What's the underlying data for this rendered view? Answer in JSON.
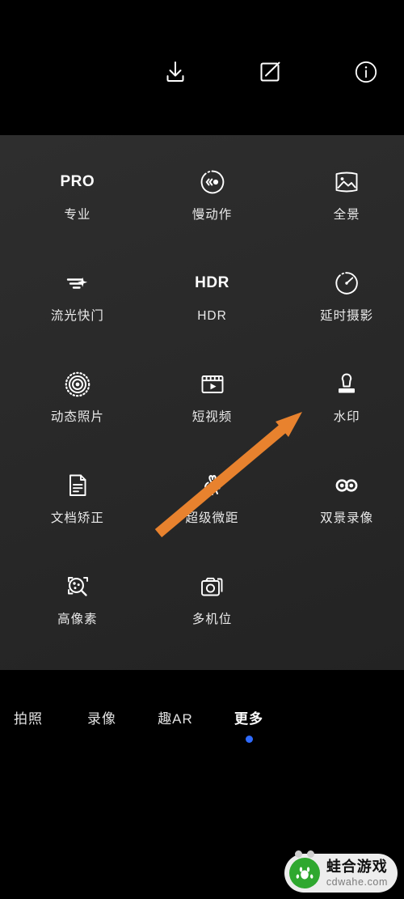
{
  "app": {
    "background_color": "#000000",
    "panel_color": "#2b2b2b"
  },
  "toolbar": {
    "buttons": [
      {
        "name": "download-icon",
        "label": "下载"
      },
      {
        "name": "edit-icon",
        "label": "编辑"
      },
      {
        "name": "info-icon",
        "label": "详情"
      }
    ]
  },
  "mode_panel": {
    "rows": [
      [
        {
          "icon": "pro-text-icon",
          "icon_text": "PRO",
          "label": "专业"
        },
        {
          "icon": "slow-motion-icon",
          "icon_text": "",
          "label": "慢动作"
        },
        {
          "icon": "panorama-icon",
          "icon_text": "",
          "label": "全景"
        }
      ],
      [
        {
          "icon": "light-painting-icon",
          "icon_text": "",
          "label": "流光快门"
        },
        {
          "icon": "hdr-text-icon",
          "icon_text": "HDR",
          "label": "HDR"
        },
        {
          "icon": "time-lapse-icon",
          "icon_text": "",
          "label": "延时摄影"
        }
      ],
      [
        {
          "icon": "live-photo-icon",
          "icon_text": "",
          "label": "动态照片"
        },
        {
          "icon": "short-video-icon",
          "icon_text": "",
          "label": "短视频"
        },
        {
          "icon": "watermark-stamp-icon",
          "icon_text": "",
          "label": "水印"
        }
      ],
      [
        {
          "icon": "document-correction-icon",
          "icon_text": "",
          "label": "文档矫正"
        },
        {
          "icon": "super-macro-icon",
          "icon_text": "",
          "label": "超级微距"
        },
        {
          "icon": "dual-view-video-icon",
          "icon_text": "",
          "label": "双景录像"
        }
      ],
      [
        {
          "icon": "high-resolution-icon",
          "icon_text": "",
          "label": "高像素"
        },
        {
          "icon": "multi-camera-icon",
          "icon_text": "",
          "label": "多机位"
        },
        {
          "icon": "",
          "icon_text": "",
          "label": ""
        }
      ]
    ]
  },
  "tabbar": {
    "active_index": 3,
    "active_dot_color": "#2f6bff",
    "tabs": [
      {
        "label": "拍照"
      },
      {
        "label": "录像"
      },
      {
        "label": "趣AR"
      },
      {
        "label": "更多"
      }
    ]
  },
  "annotation": {
    "arrow_color": "#e8822e",
    "points_to": "水印"
  },
  "watermark": {
    "site_name": "蛙合游戏",
    "site_url": "cdwahe.com",
    "logo_color": "#2fa82f"
  }
}
